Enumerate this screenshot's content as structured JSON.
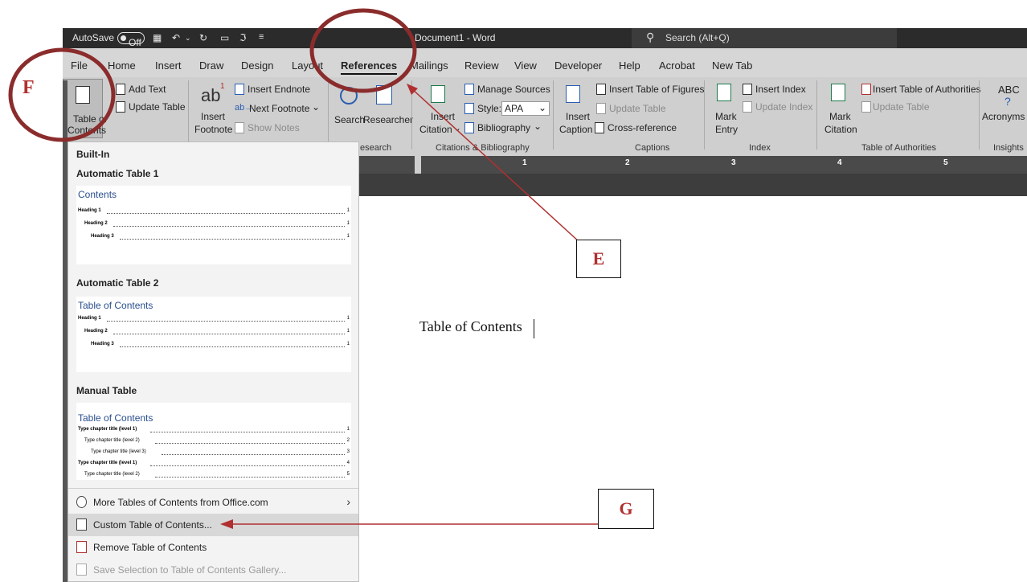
{
  "titlebar": {
    "autosave": "AutoSave",
    "autosave_state": "Off",
    "doc_title": "Document1 - Word",
    "search_placeholder": "Search (Alt+Q)"
  },
  "tabs": [
    "File",
    "Home",
    "Insert",
    "Draw",
    "Design",
    "Layout",
    "References",
    "Mailings",
    "Review",
    "View",
    "Developer",
    "Help",
    "Acrobat",
    "New Tab"
  ],
  "active_tab": "References",
  "ribbon": {
    "toc": {
      "btn": "Table of Contents",
      "btn_line1": "Table of",
      "btn_line2": "Contents",
      "add_text": "Add Text",
      "update_table": "Update Table"
    },
    "footnotes": {
      "ab": "ab",
      "insert_footnote_line1": "Insert",
      "insert_footnote_line2": "Footnote",
      "insert_endnote": "Insert Endnote",
      "next_footnote": "Next Footnote",
      "show_notes": "Show Notes"
    },
    "research": {
      "search": "Search",
      "researcher": "Researcher",
      "group": "Research",
      "group_visible": "esearch"
    },
    "citations": {
      "insert_citation_line1": "Insert",
      "insert_citation_line2": "Citation",
      "manage_sources": "Manage Sources",
      "style_label": "Style:",
      "style_value": "APA",
      "bibliography": "Bibliography",
      "group": "Citations & Bibliography"
    },
    "captions": {
      "insert_caption_line1": "Insert",
      "insert_caption_line2": "Caption",
      "insert_table_of_figures": "Insert Table of Figures",
      "update_table": "Update Table",
      "cross_reference": "Cross-reference",
      "group": "Captions"
    },
    "index": {
      "mark_entry_line1": "Mark",
      "mark_entry_line2": "Entry",
      "insert_index": "Insert Index",
      "update_index": "Update Index",
      "group": "Index"
    },
    "authorities": {
      "mark_citation_line1": "Mark",
      "mark_citation_line2": "Citation",
      "insert_table_of_authorities": "Insert Table of Authorities",
      "update_table": "Update Table",
      "group": "Table of Authorities"
    },
    "insights": {
      "abc": "ABC",
      "q": "?",
      "acronyms": "Acronyms",
      "group": "Insights"
    }
  },
  "ruler_numbers": [
    "1",
    "2",
    "3",
    "4",
    "5"
  ],
  "dropdown": {
    "built_in": "Built-In",
    "auto1": {
      "header": "Automatic Table 1",
      "title": "Contents",
      "rows": [
        {
          "text": "Heading 1",
          "page": "1"
        },
        {
          "text": "Heading 2",
          "page": "1"
        },
        {
          "text": "Heading 3",
          "page": "1"
        }
      ]
    },
    "auto2": {
      "header": "Automatic Table 2",
      "title": "Table of Contents",
      "rows": [
        {
          "text": "Heading 1",
          "page": "1"
        },
        {
          "text": "Heading 2",
          "page": "1"
        },
        {
          "text": "Heading 3",
          "page": "1"
        }
      ]
    },
    "manual": {
      "header": "Manual Table",
      "title": "Table of Contents",
      "rows": [
        {
          "text": "Type chapter title (level 1)",
          "page": "1"
        },
        {
          "text": "Type chapter title (level 2)",
          "page": "2"
        },
        {
          "text": "Type chapter title (level 3)",
          "page": "3"
        },
        {
          "text": "Type chapter title (level 1)",
          "page": "4"
        },
        {
          "text": "Type chapter title (level 2)",
          "page": "5"
        }
      ]
    },
    "menu": {
      "more": "More Tables of Contents from Office.com",
      "custom": "Custom Table of Contents...",
      "remove": "Remove Table of Contents",
      "save": "Save Selection to Table of Contents Gallery..."
    }
  },
  "document": {
    "text": "Table of Contents"
  },
  "annotations": {
    "e": "E",
    "f": "F",
    "g": "G"
  },
  "colors": {
    "annotation": "#b03030",
    "titlebar": "#2b2b2b",
    "ribbon": "#cfcfcf"
  }
}
